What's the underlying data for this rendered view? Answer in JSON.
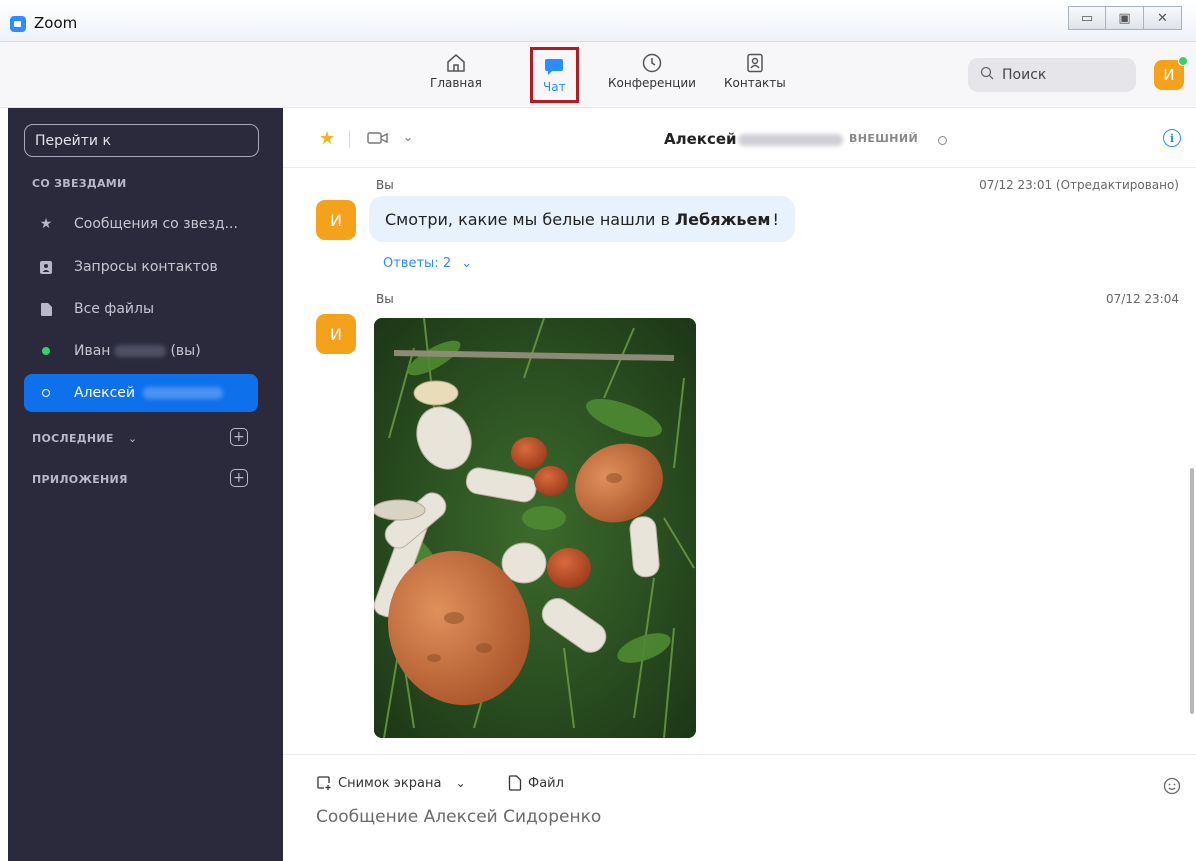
{
  "window": {
    "title": "Zoom",
    "buttons": [
      "▭",
      "▣",
      "✕"
    ]
  },
  "topnav": {
    "items": [
      {
        "label": "Главная",
        "icon": "home-icon"
      },
      {
        "label": "Чат",
        "icon": "chat-bubble-icon",
        "active": true
      },
      {
        "label": "Конференции",
        "icon": "clock-icon"
      },
      {
        "label": "Контакты",
        "icon": "contact-card-icon"
      }
    ],
    "search_placeholder": "Поиск",
    "avatar_initial": "И"
  },
  "sidebar": {
    "goto_label": "Перейти к",
    "sections": {
      "starred": "СО ЗВЕЗДАМИ",
      "recent": "ПОСЛЕДНИЕ",
      "apps": "ПРИЛОЖЕНИЯ"
    },
    "items": [
      {
        "label": "Сообщения со звезд...",
        "icon": "star-icon"
      },
      {
        "label": "Запросы контактов",
        "icon": "contact-request-icon"
      },
      {
        "label": "Все файлы",
        "icon": "file-icon"
      },
      {
        "label": "Иван",
        "suffix": "(вы)",
        "icon": "online-dot-icon"
      },
      {
        "label": "Алексей",
        "icon": "offline-dot-icon",
        "active": true
      }
    ]
  },
  "chat": {
    "contact_name": "Алексей",
    "external_badge": "ВНЕШНИЙ",
    "messages": [
      {
        "sender": "Вы",
        "time": "07/12 23:01 (Отредактировано)",
        "avatar": "И",
        "text_before": "Смотри, какие мы белые нашли в",
        "text_bold": "Лебяжьем",
        "text_after": "!",
        "replies": "Ответы: 2"
      },
      {
        "sender": "Вы",
        "time": "07/12 23:04",
        "avatar": "И",
        "image": "mushrooms-photo"
      }
    ]
  },
  "composer": {
    "screenshot_label": "Снимок экрана",
    "file_label": "Файл",
    "placeholder": "Сообщение Алексей Сидоренко"
  },
  "colors": {
    "accent": "#2d8cff",
    "sidebar_bg": "#2a2a3c",
    "active_item": "#0e71eb",
    "avatar": "#f4a21c",
    "highlight_border": "#b01c22"
  }
}
